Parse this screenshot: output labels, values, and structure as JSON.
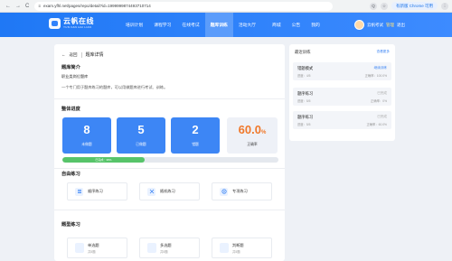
{
  "browser": {
    "url": "exam.yfhl.net/pages/repo/detail?id=1999999874493710714",
    "update_label": "有新版 Chrome 可用",
    "nav_back": "←",
    "nav_forward": "→",
    "nav_reload": "C",
    "url_icon": "≡",
    "right_icon1": "Q",
    "right_icon2": "☆",
    "right_icon3": "⋮"
  },
  "header": {
    "logo_cn": "云帆在线",
    "logo_en": "YUN FAN HAI LIAN",
    "nav": [
      "培训计划",
      "课程学习",
      "在线考试",
      "题库训练",
      "活动大厅",
      "商城",
      "公告",
      "我的"
    ],
    "user_name": "云帆考试",
    "user_role": "管理",
    "logout": "退出"
  },
  "main": {
    "back_label": "返回",
    "page_title": "题库详情",
    "intro_title": "题库简介",
    "repo_name": "职业类岗位题库",
    "repo_desc": "一个专门用于题库练习的题库，可以用做题库进行考试、训练。",
    "progress_title": "整体进度",
    "stats": [
      {
        "num": "8",
        "label": "未做题"
      },
      {
        "num": "5",
        "label": "已做题"
      },
      {
        "num": "2",
        "label": "错题"
      }
    ],
    "rate_num": "60.0",
    "rate_unit": "%",
    "rate_label": "正确率",
    "progress_label": "已完成：38%",
    "progress": 0.38,
    "practice_title": "自由练习",
    "practice": [
      "顺序练习",
      "随机练习",
      "专项练习"
    ],
    "types_title": "题型练习",
    "types": [
      {
        "name": "单选题",
        "sub": "共5题"
      },
      {
        "name": "多选题",
        "sub": "共5题"
      },
      {
        "name": "判断题",
        "sub": "共5题"
      }
    ]
  },
  "sidebar": {
    "title": "最近训练",
    "more": "查看更多",
    "records": [
      {
        "name": "错题模式",
        "sub": "进度：4/5",
        "action": "继续训练",
        "rate": "正确率：100.0%",
        "done": false
      },
      {
        "name": "题序练习",
        "sub": "进度：5/5",
        "action": "已完成",
        "rate": "正确率：0%",
        "done": true
      },
      {
        "name": "题序练习",
        "sub": "进度：5/5",
        "action": "已完成",
        "rate": "正确率：60.0%",
        "done": true
      }
    ]
  },
  "colors": {
    "brand": "#1f78f5",
    "accent_orange": "#f0792b",
    "progress_green": "#57c46a"
  }
}
